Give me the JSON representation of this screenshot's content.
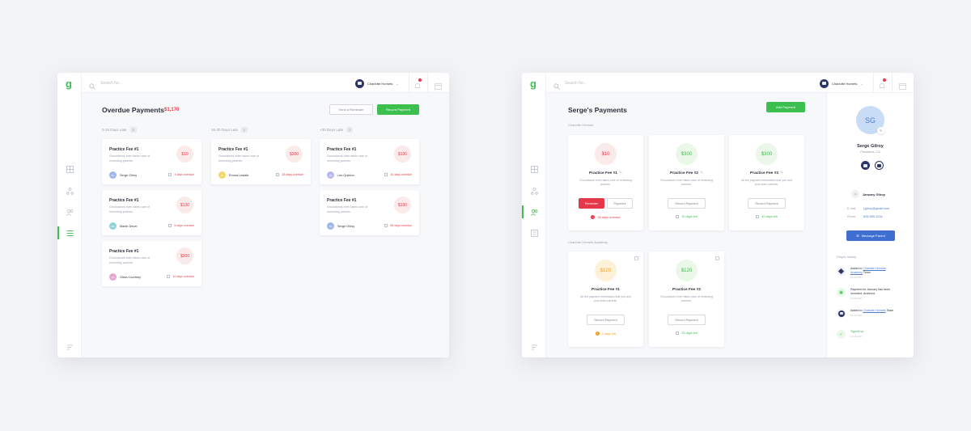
{
  "brand": {
    "logo": "g",
    "accent": "#3dbf4f"
  },
  "search": {
    "placeholder": "Search for..."
  },
  "team": {
    "name": "Charlotte Hornets"
  },
  "overdue": {
    "title": "Overdue Payments",
    "total": "$1,170",
    "send_reminder_label": "Send a Reminder",
    "record_payment_label": "Record Payment",
    "columns": [
      {
        "label": "0-15 Days Late",
        "count": "3",
        "cards": [
          {
            "title": "Practice Fee #1",
            "desc": "Groundwork even takes care of reminding parents.",
            "amount": "$10",
            "person": "Serge Gilroy",
            "initials": "SG",
            "overdue": "3 days overdue"
          },
          {
            "title": "Practice Fee #1",
            "desc": "Groundwork even takes care of reminding parents.",
            "amount": "$130",
            "person": "Martin Dever",
            "initials": "MD",
            "overdue": "5 days overdue"
          },
          {
            "title": "Practice Fee #1",
            "desc": "Groundwork even takes care of reminding parents.",
            "amount": "$300",
            "person": "Olivia Courtney",
            "initials": "OC",
            "overdue": "10 days overdue"
          }
        ]
      },
      {
        "label": "16-30 Days Late",
        "count": "1",
        "cards": [
          {
            "title": "Practice Fee #1",
            "desc": "Groundwork even takes care of reminding parents.",
            "amount": "$300",
            "person": "Emma Lindale",
            "initials": "EL",
            "overdue": "28 days overdue"
          }
        ]
      },
      {
        "label": "+30 Days Late",
        "count": "2",
        "cards": [
          {
            "title": "Practice Fee #1",
            "desc": "Groundwork even takes care of reminding parents.",
            "amount": "$130",
            "person": "Leo Quinton",
            "initials": "LQ",
            "overdue": "40 days overdue"
          },
          {
            "title": "Practice Fee #1",
            "desc": "Groundwork even takes care of reminding parents.",
            "amount": "$130",
            "person": "Serge Gilroy",
            "initials": "SG",
            "overdue": "56 days overdue"
          }
        ]
      }
    ]
  },
  "serge": {
    "title": "Serge's Payments",
    "add_payment_label": "Add Payment",
    "groups": [
      {
        "label": "Charlotte Hornets",
        "cards": [
          {
            "amount": "$10",
            "title": "Practice Fee #1",
            "desc": "Groundwork even takes care of reminding parents.",
            "btn1": "Reminder",
            "btn2": "Payment",
            "status": "28 days overdue"
          },
          {
            "amount": "$300",
            "title": "Practice Fee #2",
            "desc": "Groundwork even takes care of reminding parents.",
            "btn1": "Record Payment",
            "status": "10 days left"
          },
          {
            "amount": "$300",
            "title": "Practice Fee #3",
            "desc": "All the payment information that you and your team parents.",
            "btn1": "Record Payment",
            "status": "40 days left"
          }
        ]
      },
      {
        "label": "Charlotte Hornets Academy",
        "cards": [
          {
            "amount": "$120",
            "title": "Practice Fee #1",
            "desc": "All the payment information that you and your team parents.",
            "btn1": "Record Payment",
            "status": "2 days left"
          },
          {
            "amount": "$120",
            "title": "Practice Fee #2",
            "desc": "Groundwork even takes care of reminding parents.",
            "btn1": "Record Payment",
            "status": "33 days left"
          }
        ]
      }
    ]
  },
  "profile": {
    "initials": "SG",
    "name": "Serge Gilroy",
    "location": "Pasadena, CA",
    "parent": {
      "initials": "JG",
      "name": "January Gilroy"
    },
    "email_label": "E-mail",
    "email": "j.gilroy@gmail.com",
    "phone_label": "Phone",
    "phone": "626-555-1234",
    "message_label": "Message Parent",
    "history_title": "Player history",
    "history": [
      {
        "pre": "Added to ",
        "link": "Charlotte Hornets Academy",
        "post": " Team",
        "date": "22.02.2017"
      },
      {
        "pre": "Payment for January has been recorded. Archived.",
        "link": "",
        "post": "",
        "date": "18.02.2017"
      },
      {
        "pre": "Added to ",
        "link": "Charlotte Hornets",
        "post": " Team",
        "date": "12.02.2017"
      },
      {
        "pre": "Signed up",
        "link": "",
        "post": "",
        "date": "11.02.2017"
      }
    ]
  },
  "colors": {
    "danger": "#e53a4a",
    "success": "#3dbf4f",
    "warning": "#f0a020",
    "primary": "#3f6fd1"
  },
  "icons": [
    "search-icon",
    "bell-icon",
    "calendar-icon",
    "dashboard-icon",
    "org-icon",
    "people-icon",
    "list-icon",
    "chat-icon"
  ]
}
